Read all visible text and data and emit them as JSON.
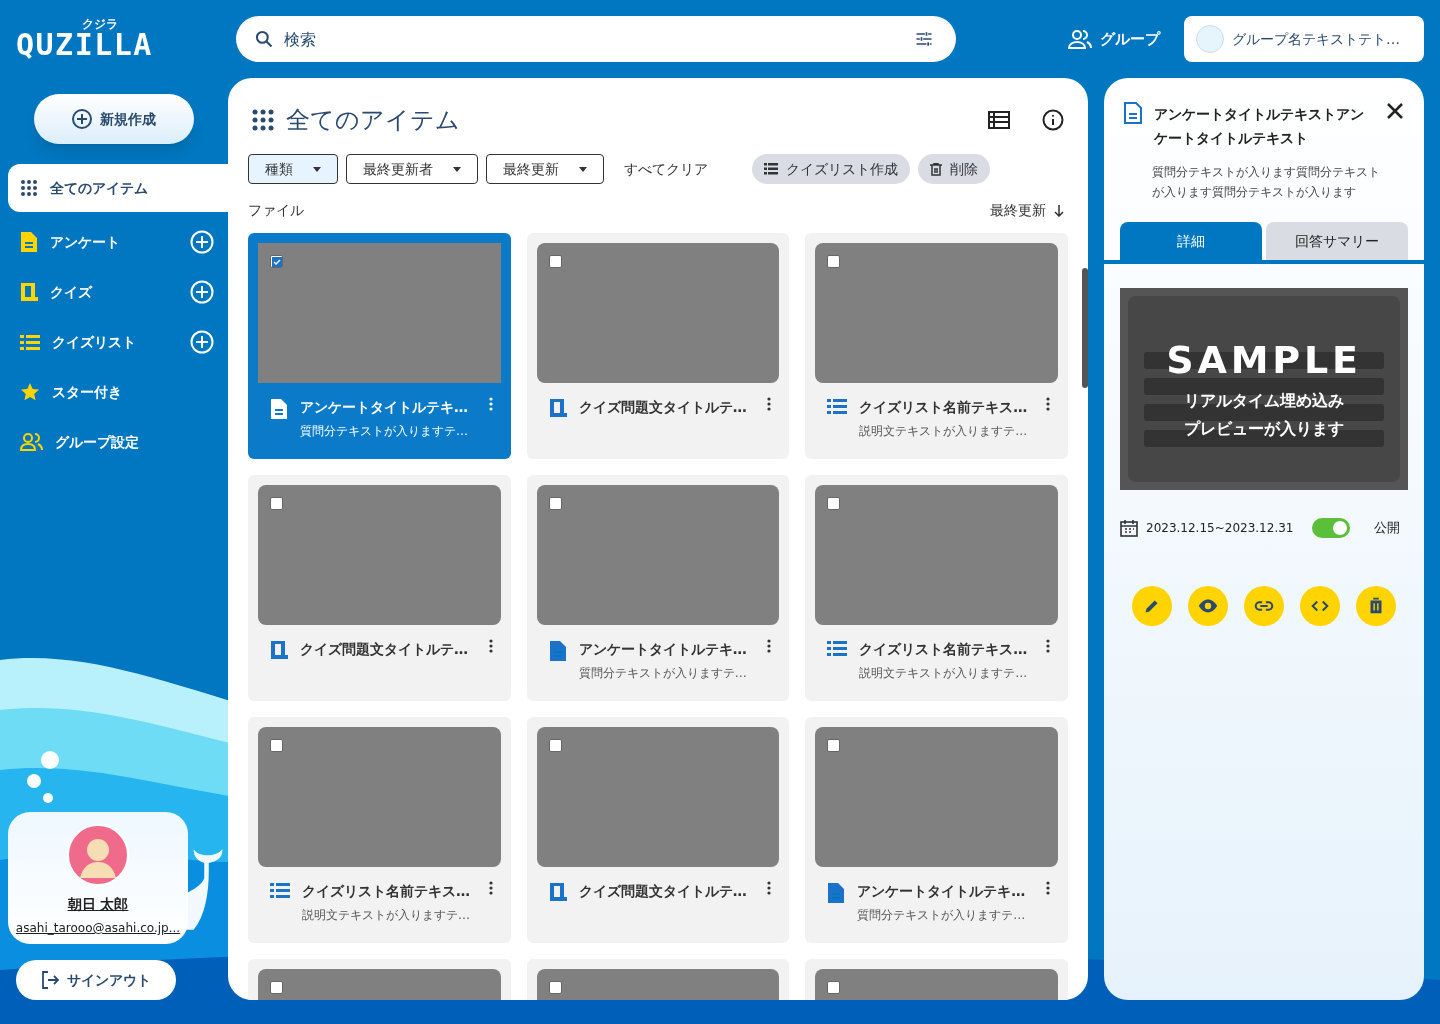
{
  "logo": {
    "text": "QUZILLA",
    "ruby": "クジラ"
  },
  "search": {
    "placeholder": "検索"
  },
  "header": {
    "group_label": "グループ",
    "group_name": "グループ名テキストテト…"
  },
  "sidebar": {
    "new_button": "新規作成",
    "items": [
      {
        "kind": "all",
        "label": "全てのアイテム",
        "selected": true,
        "addable": false
      },
      {
        "kind": "survey",
        "label": "アンケート",
        "selected": false,
        "addable": true
      },
      {
        "kind": "quiz",
        "label": "クイズ",
        "selected": false,
        "addable": true
      },
      {
        "kind": "quizlist",
        "label": "クイズリスト",
        "selected": false,
        "addable": true
      },
      {
        "kind": "star",
        "label": "スター付き",
        "selected": false,
        "addable": false
      },
      {
        "kind": "group",
        "label": "グループ設定",
        "selected": false,
        "addable": false
      }
    ],
    "user": {
      "name": "朝日 太郎",
      "email": "asahi_tarooo@asahi.co.jp..."
    },
    "signout": "サインアウト"
  },
  "main": {
    "title": "全てのアイテム",
    "filters": [
      {
        "label": "種類",
        "active": true
      },
      {
        "label": "最終更新者",
        "active": false
      },
      {
        "label": "最終更新",
        "active": false
      }
    ],
    "clear": "すべてクリア",
    "actions": [
      {
        "kind": "list",
        "label": "クイズリスト作成"
      },
      {
        "kind": "trash",
        "label": "削除"
      }
    ],
    "section": "ファイル",
    "sort": "最終更新",
    "cards": [
      {
        "kind": "survey",
        "title": "アンケートタイトルテキ…",
        "subtitle": "質問分テキストが入りますテ…",
        "checked": true,
        "selected": true
      },
      {
        "kind": "quiz",
        "title": "クイズ問題文タイトルテ…",
        "checked": false,
        "selected": false
      },
      {
        "kind": "quizlist",
        "title": "クイズリスト名前テキス…",
        "subtitle": "説明文テキストが入りますテ…",
        "checked": false,
        "selected": false
      },
      {
        "kind": "quiz",
        "title": "クイズ問題文タイトルテ…",
        "checked": false,
        "selected": false
      },
      {
        "kind": "survey",
        "title": "アンケートタイトルテキ…",
        "subtitle": "質問分テキストが入りますテ…",
        "checked": false,
        "selected": false
      },
      {
        "kind": "quizlist",
        "title": "クイズリスト名前テキス…",
        "subtitle": "説明文テキストが入りますテ…",
        "checked": false,
        "selected": false
      },
      {
        "kind": "quizlist",
        "title": "クイズリスト名前テキス…",
        "subtitle": "説明文テキストが入りますテ…",
        "checked": false,
        "selected": false
      },
      {
        "kind": "quiz",
        "title": "クイズ問題文タイトルテ…",
        "checked": false,
        "selected": false
      },
      {
        "kind": "survey",
        "title": "アンケートタイトルテキ…",
        "subtitle": "質問分テキストが入りますテ…",
        "checked": false,
        "selected": false
      },
      {
        "checked": false,
        "selected": false
      },
      {
        "checked": false,
        "selected": false
      },
      {
        "checked": false,
        "selected": false
      }
    ]
  },
  "detail": {
    "title": "アンケートタイトルテキストアンケートタイトルテキスト",
    "description": "質問分テキストが入ります質問分テキストが入ります質問分テキストが入ります",
    "tabs": [
      {
        "label": "詳細",
        "selected": true
      },
      {
        "label": "回答サマリー",
        "selected": false
      }
    ],
    "preview": {
      "watermark": "SAMPLE",
      "caption_1": "リアルタイム埋め込み",
      "caption_2": "プレビューが入ります"
    },
    "period": "2023.12.15~2023.12.31",
    "public": {
      "label": "公開",
      "on": true
    },
    "actions": [
      {
        "kind": "edit"
      },
      {
        "kind": "view"
      },
      {
        "kind": "link"
      },
      {
        "kind": "embed"
      },
      {
        "kind": "delete"
      }
    ]
  }
}
